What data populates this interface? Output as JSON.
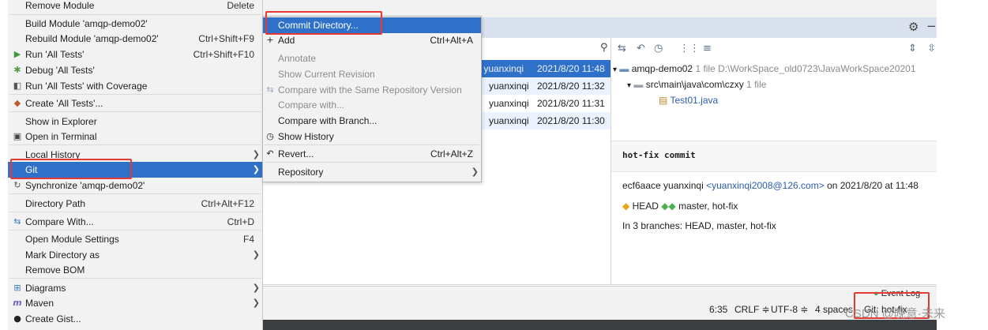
{
  "colors": {
    "selection": "#2f71c8",
    "annotation_red": "#e53935",
    "menu_bg": "#f2f2f2",
    "link": "#2a5db0"
  },
  "context_menu": {
    "items": [
      {
        "label": "Remove Module",
        "shortcut": "Delete",
        "icon": ""
      },
      {
        "label": "Build Module 'amqp-demo02'",
        "shortcut": "",
        "icon": ""
      },
      {
        "label": "Rebuild Module 'amqp-demo02'",
        "shortcut": "Ctrl+Shift+F9",
        "icon": ""
      },
      {
        "label": "Run 'All Tests'",
        "shortcut": "Ctrl+Shift+F10",
        "icon": "run-icon"
      },
      {
        "label": "Debug 'All Tests'",
        "shortcut": "",
        "icon": "debug-icon"
      },
      {
        "label": "Run 'All Tests' with Coverage",
        "shortcut": "",
        "icon": "coverage-icon"
      },
      {
        "label": "Create 'All Tests'...",
        "shortcut": "",
        "icon": "create-config-icon"
      },
      {
        "label": "Show in Explorer",
        "shortcut": "",
        "icon": ""
      },
      {
        "label": "Open in Terminal",
        "shortcut": "",
        "icon": "terminal-icon"
      },
      {
        "label": "Local History",
        "shortcut": "",
        "icon": "",
        "submenu": true
      },
      {
        "label": "Git",
        "shortcut": "",
        "icon": "",
        "submenu": true,
        "selected": true
      },
      {
        "label": "Synchronize 'amqp-demo02'",
        "shortcut": "",
        "icon": "sync-icon"
      },
      {
        "label": "Directory Path",
        "shortcut": "Ctrl+Alt+F12",
        "icon": ""
      },
      {
        "label": "Compare With...",
        "shortcut": "Ctrl+D",
        "icon": "compare-icon"
      },
      {
        "label": "Open Module Settings",
        "shortcut": "F4",
        "icon": ""
      },
      {
        "label": "Mark Directory as",
        "shortcut": "",
        "icon": "",
        "submenu": true
      },
      {
        "label": "Remove BOM",
        "shortcut": "",
        "icon": ""
      },
      {
        "label": "Diagrams",
        "shortcut": "",
        "icon": "diagrams-icon",
        "submenu": true
      },
      {
        "label": "Maven",
        "shortcut": "",
        "icon": "maven-icon",
        "submenu": true
      },
      {
        "label": "Create Gist...",
        "shortcut": "",
        "icon": "github-icon"
      }
    ]
  },
  "git_submenu": {
    "items": [
      {
        "label": "Commit Directory...",
        "shortcut": "",
        "selected": true
      },
      {
        "label": "Add",
        "shortcut": "Ctrl+Alt+A",
        "icon": "add-icon"
      },
      {
        "label": "Annotate",
        "shortcut": "",
        "disabled": true
      },
      {
        "label": "Show Current Revision",
        "shortcut": "",
        "disabled": true
      },
      {
        "label": "Compare with the Same Repository Version",
        "shortcut": "",
        "disabled": true,
        "icon": "compare-icon"
      },
      {
        "label": "Compare with...",
        "shortcut": "",
        "disabled": true
      },
      {
        "label": "Compare with Branch...",
        "shortcut": ""
      },
      {
        "label": "Show History",
        "shortcut": "",
        "icon": "history-icon"
      },
      {
        "label": "Revert...",
        "shortcut": "Ctrl+Alt+Z",
        "icon": "revert-icon"
      },
      {
        "label": "Repository",
        "shortcut": "",
        "submenu": true
      }
    ]
  },
  "log": {
    "search_icon": "search-icon",
    "rows": [
      {
        "author": "r yuanxinqi",
        "date": "2021/8/20 11:48",
        "selected": true
      },
      {
        "author": "yuanxinqi",
        "date": "2021/8/20 11:32"
      },
      {
        "author": "yuanxinqi",
        "date": "2021/8/20 11:31"
      },
      {
        "author": "yuanxinqi",
        "date": "2021/8/20 11:30"
      }
    ]
  },
  "changes_tree": {
    "root_name": "amqp-demo02",
    "root_meta": "1 file  D:\\WorkSpace_old0723\\JavaWorkSpace20201",
    "dir_name": "src\\main\\java\\com\\czxy",
    "dir_meta": "1 file",
    "file_name": "Test01.java"
  },
  "commit_details": {
    "message": "hot-fix commit",
    "hash_author": "ecf6aace yuanxinqi",
    "email": "<yuanxinqi2008@126.com>",
    "on_date": "on 2021/8/20 at 11:48",
    "ref_head": "HEAD",
    "ref_branches": "master, hot-fix",
    "branches_line": "In 3 branches: HEAD, master, hot-fix"
  },
  "status_bar": {
    "event_log": "Event Log",
    "position": "6:35",
    "line_sep": "CRLF ≑",
    "encoding": "UTF-8 ≑",
    "indent": "4 spaces",
    "git_branch": "Git: hot-fix"
  },
  "watermark": "CSDN @晚意·未来"
}
